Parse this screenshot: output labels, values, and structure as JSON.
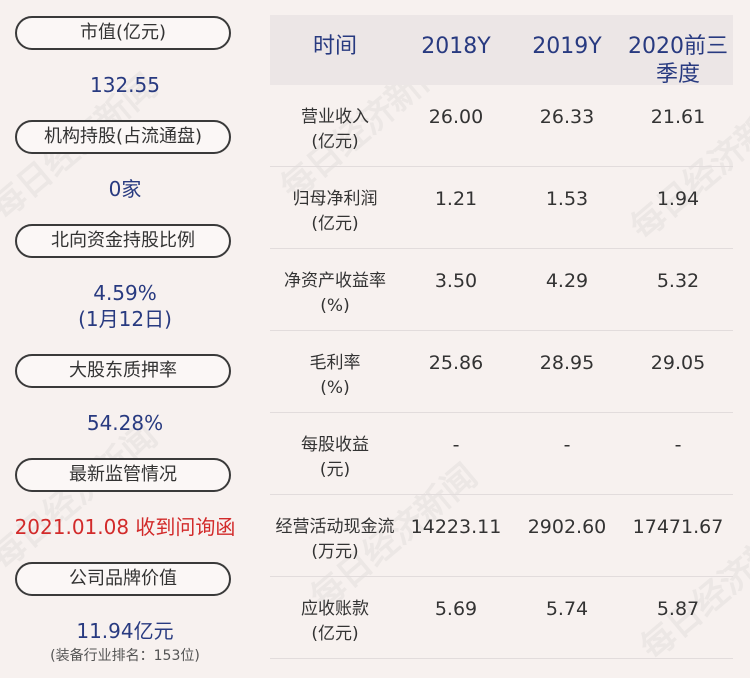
{
  "left": [
    {
      "label": "市值(亿元)",
      "value": "132.55"
    },
    {
      "label": "机构持股(占流通盘)",
      "value": "0家"
    },
    {
      "label": "北向资金持股比例",
      "value": "4.59%",
      "value2": "(1月12日)"
    },
    {
      "label": "大股东质押率",
      "value": "54.28%"
    },
    {
      "label": "最新监管情况",
      "value": "2021.01.08 收到问询函"
    },
    {
      "label": "公司品牌价值",
      "value": "11.94亿元",
      "note": "(装备行业排名：153位)"
    }
  ],
  "table": {
    "headers": [
      "时间",
      "2018Y",
      "2019Y",
      "2020前三季度"
    ],
    "rows": [
      {
        "l1": "营业收入",
        "l2": "(亿元)",
        "v": [
          "26.00",
          "26.33",
          "21.61"
        ]
      },
      {
        "l1": "归母净利润",
        "l2": "(亿元)",
        "v": [
          "1.21",
          "1.53",
          "1.94"
        ]
      },
      {
        "l1": "净资产收益率",
        "l2": "(%)",
        "v": [
          "3.50",
          "4.29",
          "5.32"
        ]
      },
      {
        "l1": "毛利率",
        "l2": "(%)",
        "v": [
          "25.86",
          "28.95",
          "29.05"
        ]
      },
      {
        "l1": "每股收益",
        "l2": "(元)",
        "v": [
          "-",
          "-",
          "-"
        ]
      },
      {
        "l1": "经营活动现金流",
        "l2": "(万元)",
        "v": [
          "14223.11",
          "2902.60",
          "17471.67"
        ]
      },
      {
        "l1": "应收账款",
        "l2": "(亿元)",
        "v": [
          "5.69",
          "5.74",
          "5.87"
        ]
      }
    ]
  },
  "watermark": "每日经济新闻",
  "colors": {
    "accent": "#283a80",
    "alert": "#d22a2a",
    "background": "#f7f1ef",
    "header_bg": "#ece6e6"
  }
}
